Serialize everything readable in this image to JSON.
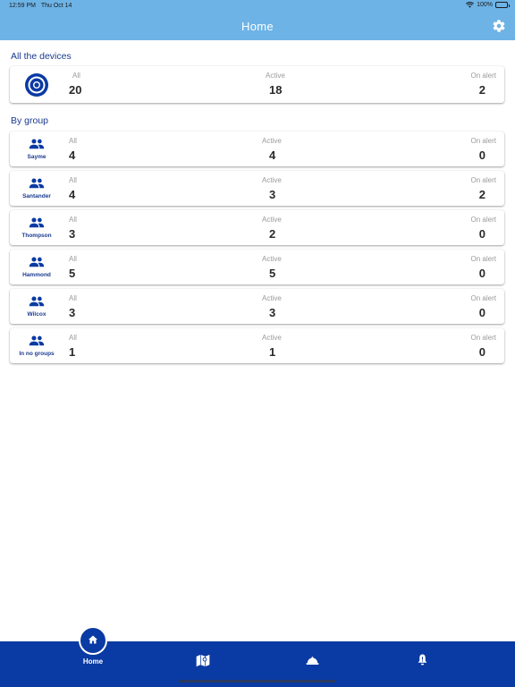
{
  "status": {
    "time": "12:59 PM",
    "date": "Thu Oct 14",
    "battery": "100%"
  },
  "header": {
    "title": "Home",
    "settings_icon": "gear-icon"
  },
  "all_devices": {
    "section_title": "All the devices",
    "labels": {
      "all": "All",
      "active": "Active",
      "alert": "On alert"
    },
    "all": "20",
    "active": "18",
    "alert": "2"
  },
  "by_group": {
    "section_title": "By group",
    "groups": [
      {
        "name": "Sayme",
        "all": "4",
        "active": "4",
        "alert": "0"
      },
      {
        "name": "Santander",
        "all": "4",
        "active": "3",
        "alert": "2"
      },
      {
        "name": "Thompson",
        "all": "3",
        "active": "2",
        "alert": "0"
      },
      {
        "name": "Hammond",
        "all": "5",
        "active": "5",
        "alert": "0"
      },
      {
        "name": "Wilcox",
        "all": "3",
        "active": "3",
        "alert": "0"
      },
      {
        "name": "In no groups",
        "all": "1",
        "active": "1",
        "alert": "0"
      }
    ]
  },
  "tabbar": {
    "home_label": "Home",
    "tabs": [
      {
        "icon": "home-icon"
      },
      {
        "icon": "map-icon"
      },
      {
        "icon": "hardhat-icon"
      },
      {
        "icon": "bell-alert-icon"
      }
    ]
  },
  "colors": {
    "header": "#6db3e6",
    "primary": "#0a3aa3",
    "title_text": "#1a3a8f"
  }
}
